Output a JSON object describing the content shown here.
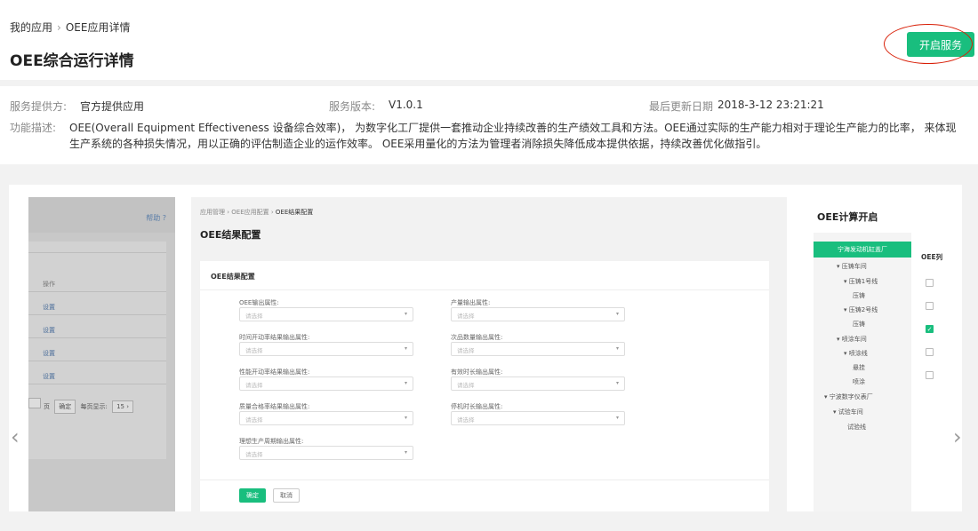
{
  "breadcrumb": {
    "root": "我的应用",
    "sep": "›",
    "current": "OEE应用详情"
  },
  "page_title": "OEE综合运行详情",
  "start_button": "开启服务",
  "info": {
    "provider_label": "服务提供方:",
    "provider_value": "官方提供应用",
    "version_label": "服务版本:",
    "version_value": "V1.0.1",
    "updated_label": "最后更新日期",
    "updated_value": "2018-3-12 23:21:21",
    "desc_label": "功能描述:",
    "desc_value": "OEE(Overall Equipment Effectiveness 设备综合效率)， 为数字化工厂提供一套推动企业持续改善的生产绩效工具和方法。OEE通过实际的生产能力相对于理论生产能力的比率， 来体现生产系统的各种损失情况，用以正确的评估制造企业的运作效率。 OEE采用量化的方法为管理者消除损失降低成本提供依据，持续改善优化做指引。"
  },
  "carousel": {
    "prev": "‹",
    "next": "›"
  },
  "slide1": {
    "help": "帮助 ?",
    "col_header": "操作",
    "rows": [
      "设置",
      "设置",
      "设置",
      "设置"
    ],
    "pager": {
      "page": "页",
      "confirm": "确定",
      "per_page": "每页显示:",
      "per_page_value": "15 ›"
    }
  },
  "slide2": {
    "breadcrumb": [
      "应用管理",
      "OEE应用配置",
      "OEE结果配置"
    ],
    "bread_sep": "›",
    "title": "OEE结果配置",
    "card_title": "OEE结果配置",
    "placeholder": "请选择",
    "fields_left": [
      "OEE输出属性:",
      "时间开动率结果输出属性:",
      "性能开动率结果输出属性:",
      "质量合格率结果输出属性:",
      "理想生产周期输出属性:"
    ],
    "fields_right": [
      "产量输出属性:",
      "次品数量输出属性:",
      "有效时长输出属性:",
      "停机时长输出属性:"
    ],
    "ok": "确定",
    "cancel": "取消"
  },
  "slide3": {
    "title": "OEE计算开启",
    "column_header": "OEE列",
    "tree": [
      "宁海发动机缸盖厂",
      "▾ 压铸车间",
      "▾ 压铸1号线",
      "压铸",
      "▾ 压铸2号线",
      "压铸",
      "▾ 喷涂车间",
      "▾ 喷涂线",
      "悬挂",
      "喷涂",
      "▾ 宁波数字仪表厂",
      "▾ 试验车间",
      "试验线"
    ],
    "checked_rows": [
      false,
      false,
      true,
      false,
      false
    ]
  }
}
